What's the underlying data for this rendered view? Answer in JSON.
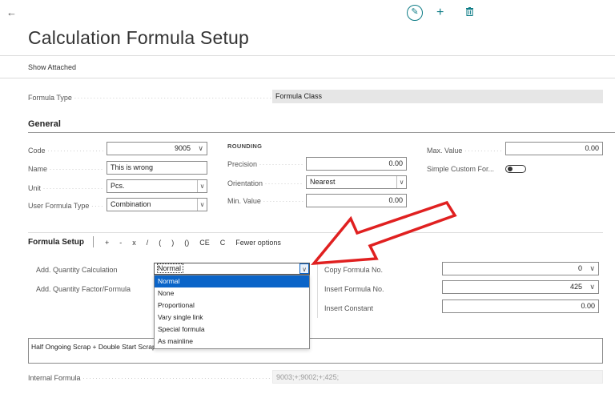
{
  "header": {
    "back_icon": "arrow-left-icon",
    "edit_icon": "pencil-icon",
    "new_icon": "plus-icon",
    "delete_icon": "trash-icon",
    "title": "Calculation Formula Setup"
  },
  "actions": {
    "show_attached": "Show Attached"
  },
  "formula_type": {
    "label": "Formula Type",
    "value": "Formula Class"
  },
  "general": {
    "title": "General",
    "code": {
      "label": "Code",
      "value": "9005"
    },
    "name": {
      "label": "Name",
      "value": "This is wrong"
    },
    "unit": {
      "label": "Unit",
      "value": "Pcs."
    },
    "user_formula_type": {
      "label": "User Formula Type",
      "value": "Combination"
    },
    "rounding": {
      "title": "ROUNDING",
      "precision": {
        "label": "Precision",
        "value": "0.00"
      },
      "orientation": {
        "label": "Orientation",
        "value": "Nearest"
      },
      "min_value": {
        "label": "Min. Value",
        "value": "0.00"
      }
    },
    "max_value": {
      "label": "Max. Value",
      "value": "0.00"
    },
    "simple_custom": {
      "label": "Simple Custom For...",
      "state": "off"
    }
  },
  "formula_setup": {
    "title": "Formula Setup",
    "ops": [
      "+",
      "-",
      "x",
      "/",
      "(",
      ")",
      "()",
      "CE",
      "C",
      "Fewer options"
    ],
    "add_qty_calc": {
      "label": "Add. Quantity Calculation",
      "value": "Normal"
    },
    "add_qty_factor": {
      "label": "Add. Quantity Factor/Formula"
    },
    "dropdown_options": [
      "Normal",
      "None",
      "Proportional",
      "Vary single link",
      "Special formula",
      "As mainline"
    ],
    "copy_formula_no": {
      "label": "Copy Formula No.",
      "value": "0"
    },
    "insert_formula_no": {
      "label": "Insert Formula No.",
      "value": "425"
    },
    "insert_constant": {
      "label": "Insert Constant",
      "value": "0.00"
    },
    "formula_text": "Half Ongoing Scrap + Double Start Scrap",
    "internal_formula": {
      "label": "Internal Formula",
      "value": "9003;+;9002;+;425;"
    }
  },
  "colors": {
    "accent": "#0e7c86",
    "selection": "#0a64c8",
    "arrow": "#e02020"
  }
}
